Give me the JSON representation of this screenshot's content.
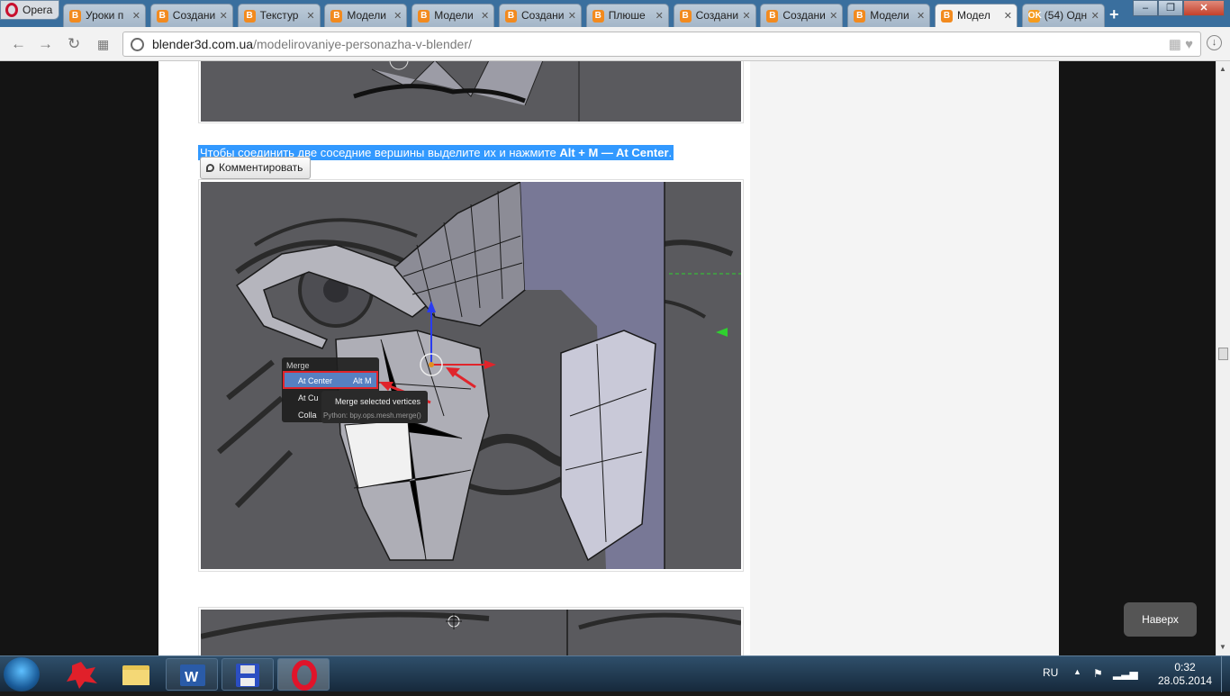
{
  "browser": {
    "menu_label": "Opera",
    "tabs": [
      {
        "label": "Уроки п",
        "favicon": "B"
      },
      {
        "label": "Создани",
        "favicon": "B"
      },
      {
        "label": "Текстур",
        "favicon": "B"
      },
      {
        "label": "Модели",
        "favicon": "B"
      },
      {
        "label": "Модели",
        "favicon": "B"
      },
      {
        "label": "Создани",
        "favicon": "B"
      },
      {
        "label": "Плюше",
        "favicon": "B"
      },
      {
        "label": "Создани",
        "favicon": "B"
      },
      {
        "label": "Создани",
        "favicon": "B"
      },
      {
        "label": "Модели",
        "favicon": "B"
      },
      {
        "label": "Модел",
        "favicon": "B"
      },
      {
        "label": "(54) Одн",
        "favicon": "OK"
      }
    ],
    "active_tab": 10,
    "url_domain": "blender3d.com.ua",
    "url_path": "/modelirovaniye-personazha-v-blender/"
  },
  "article": {
    "caption_text": "Чтобы соединить две соседние вершины выделите их и нажмите ",
    "caption_keys": "Alt + M — At Center",
    "caption_end": ".",
    "comment_button": "Комментировать",
    "top_button": "Наверх",
    "blender_menu": {
      "title": "Merge",
      "items": [
        "At Center",
        "At Cu",
        "Colla"
      ],
      "shortcut": "Alt M",
      "tooltip_title": "Merge selected vertices",
      "tooltip_python": "Python: bpy.ops.mesh.merge()"
    }
  },
  "taskbar": {
    "lang": "RU",
    "time": "0:32",
    "date": "28.05.2014"
  },
  "colors": {
    "selection": "#3299ff",
    "tab_bar": "#3a6f9e"
  }
}
